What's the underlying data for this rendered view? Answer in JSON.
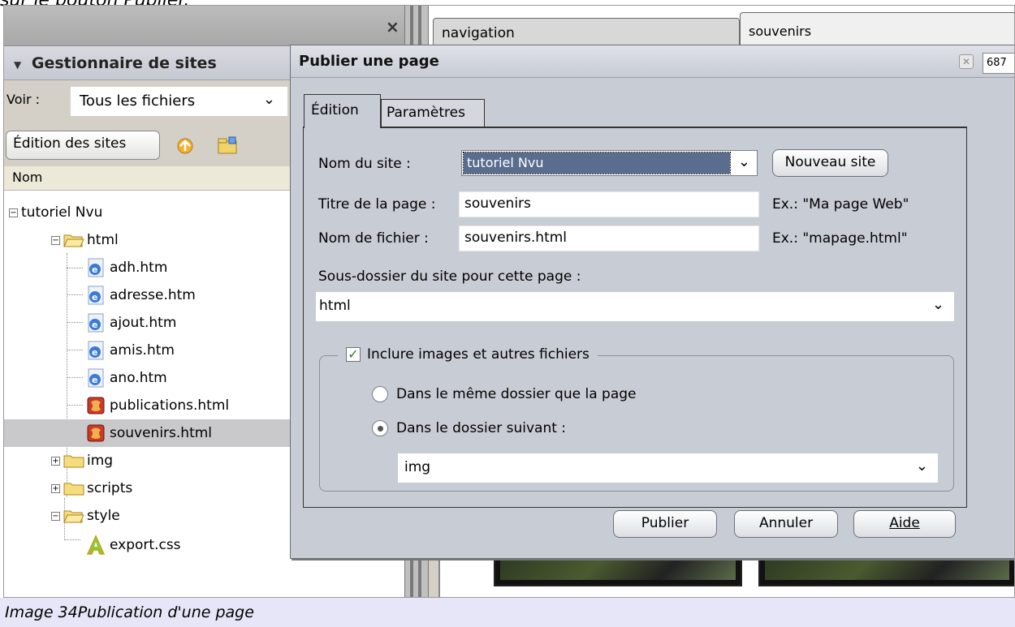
{
  "page_top_text": "sur le bouton Publier.",
  "caption": "Image 34Publication d'une page",
  "left_panel": {
    "close_glyph": "×",
    "manager_title": "Gestionnaire de sites",
    "view_label": "Voir :",
    "view_value": "Tous les fichiers",
    "edit_sites_button": "Édition des sites",
    "column_name": "Nom",
    "tree": {
      "root": "tutoriel Nvu",
      "html_folder": "html",
      "files": [
        "adh.htm",
        "adresse.htm",
        "ajout.htm",
        "amis.htm",
        "ano.htm",
        "publications.html",
        "souvenirs.html"
      ],
      "img_folder": "img",
      "scripts_folder": "scripts",
      "style_folder": "style",
      "style_file": "export.css"
    }
  },
  "editor": {
    "tabs": [
      "navigation",
      "souvenirs"
    ]
  },
  "dialog": {
    "title": "Publier une page",
    "number": "687",
    "tabs": [
      "Édition",
      "Paramètres"
    ],
    "site_name_label": "Nom du site :",
    "site_name_value": "tutoriel Nvu",
    "new_site_button": "Nouveau site",
    "page_title_label": "Titre de la page :",
    "page_title_value": "souvenirs",
    "page_title_example": "Ex.: \"Ma page Web\"",
    "filename_label": "Nom de fichier :",
    "filename_value": "souvenirs.html",
    "filename_example": "Ex.: \"mapage.html\"",
    "subfolder_label": "Sous-dossier du site pour cette page :",
    "subfolder_value": "html",
    "include_label": "Inclure images et autres fichiers",
    "include_checked": true,
    "radio_same_folder": "Dans le même dossier que la page",
    "radio_following_folder": "Dans le dossier suivant :",
    "images_folder_value": "img",
    "publish_button": "Publier",
    "cancel_button": "Annuler",
    "help_button": "Aide",
    "accent_color": "#5a6d8e"
  }
}
